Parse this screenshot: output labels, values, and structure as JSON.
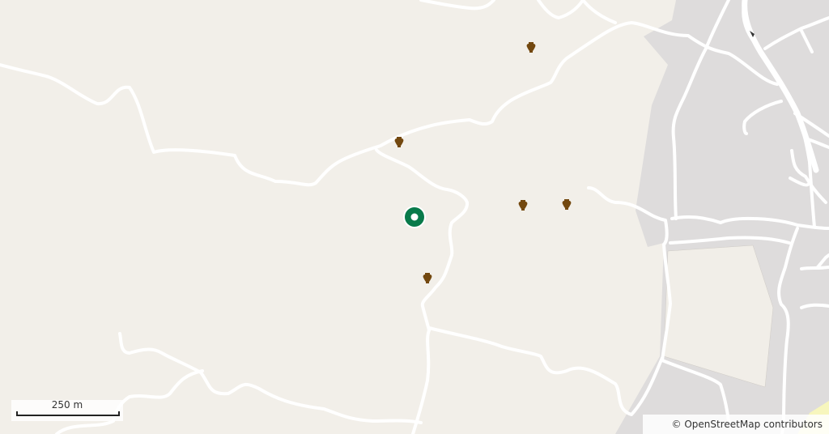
{
  "map": {
    "scale_label": "250 m",
    "attribution": "© OpenStreetMap contributors",
    "icons": {
      "poi": "amphora-icon",
      "location": "location-pin-icon",
      "oneway": "arrow-icon"
    },
    "colors": {
      "land": "#f2efe9",
      "residential": "#dfdfdf",
      "road": "#ffffff",
      "marker": "#087a4a",
      "poi": "#73480f"
    },
    "poi_count": 5
  }
}
